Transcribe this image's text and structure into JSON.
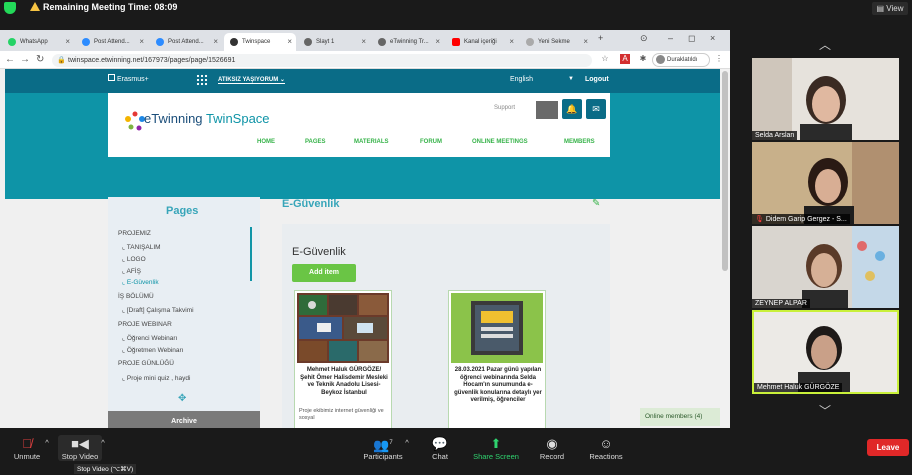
{
  "zoom": {
    "meeting_time": "Remaining Meeting Time: 08:09",
    "view_label": "View",
    "participants": [
      {
        "name": "Selda Arslan"
      },
      {
        "name": "Didem Garip Gergez - S..."
      },
      {
        "name": "ZEYNEP ALPAR"
      },
      {
        "name": "Mehmet Haluk GÜRGÖZE",
        "active": true
      }
    ],
    "toolbar": {
      "unmute": "Unmute",
      "stop_video": "Stop Video",
      "participants": "Participants",
      "participants_count": "7",
      "chat": "Chat",
      "share_screen": "Share Screen",
      "record": "Record",
      "reactions": "Reactions",
      "leave": "Leave",
      "tooltip": "Stop Video (⌥⌘V)"
    }
  },
  "browser": {
    "tabs": [
      {
        "label": "WhatsApp",
        "color": "#25d366"
      },
      {
        "label": "Post Attend...",
        "color": "#2d8cff"
      },
      {
        "label": "Post Attend...",
        "color": "#2d8cff"
      },
      {
        "label": "Twinspace",
        "color": "#333333",
        "active": true
      },
      {
        "label": "Slayt 1",
        "color": "#666666"
      },
      {
        "label": "eTwinning Tr...",
        "color": "#666666"
      },
      {
        "label": "Kanal içeriği",
        "color": "#ff0000"
      },
      {
        "label": "Yeni Sekme",
        "color": "#888888"
      }
    ],
    "url": "twinspace.etwinning.net/167973/pages/page/1526691",
    "profile": "Duraklatıldı"
  },
  "site": {
    "erasmus": "Erasmus+",
    "project": "ATIKSIZ YAŞIYORUM",
    "language": "English",
    "logout": "Logout",
    "logo_e": "eTwinning",
    "logo_t": "TwinSpace",
    "support": "Support",
    "menu": [
      "HOME",
      "PAGES",
      "MATERIALS",
      "FORUM",
      "ONLINE MEETINGS",
      "MEMBERS"
    ],
    "sidebar": {
      "title": "Pages",
      "sections": [
        {
          "heading": "PROJEMIZ",
          "items": [
            "TANIŞALIM",
            "LOGO",
            "AFİŞ",
            "E-Güvenlik"
          ]
        },
        {
          "heading": "İŞ BÖLÜMÜ",
          "items": [
            "[Draft] Çalışma Takvimi"
          ]
        },
        {
          "heading": "PROJE WEBINAR",
          "items": [
            "Öğrenci Webinarı",
            "Öğretmen Webinarı"
          ]
        },
        {
          "heading": "PROJE GÜNLÜĞÜ",
          "items": [
            "Proje mini quiz , haydi"
          ]
        }
      ],
      "archive": "Archive"
    },
    "page_title": "E-Güvenlik",
    "content_title": "E-Güvenlik",
    "add_item": "Add item",
    "cards": [
      {
        "title": "Mehmet Haluk GÜRGÖZE/ Şehit Ömer Halisdemir Mesleki ve Teknik Anadolu Lisesi- Beykoz İstanbul",
        "body": "Proje ekibimiz internet güvenliği ve sosyal"
      },
      {
        "title": "28.03.2021 Pazar günü yapılan öğrenci webinarında Selda Hocam'ın sunumunda e-güvenlik konularına detaylı yer verilmiş, öğrenciler",
        "body": ""
      }
    ],
    "online_members": "Online members (4)"
  }
}
